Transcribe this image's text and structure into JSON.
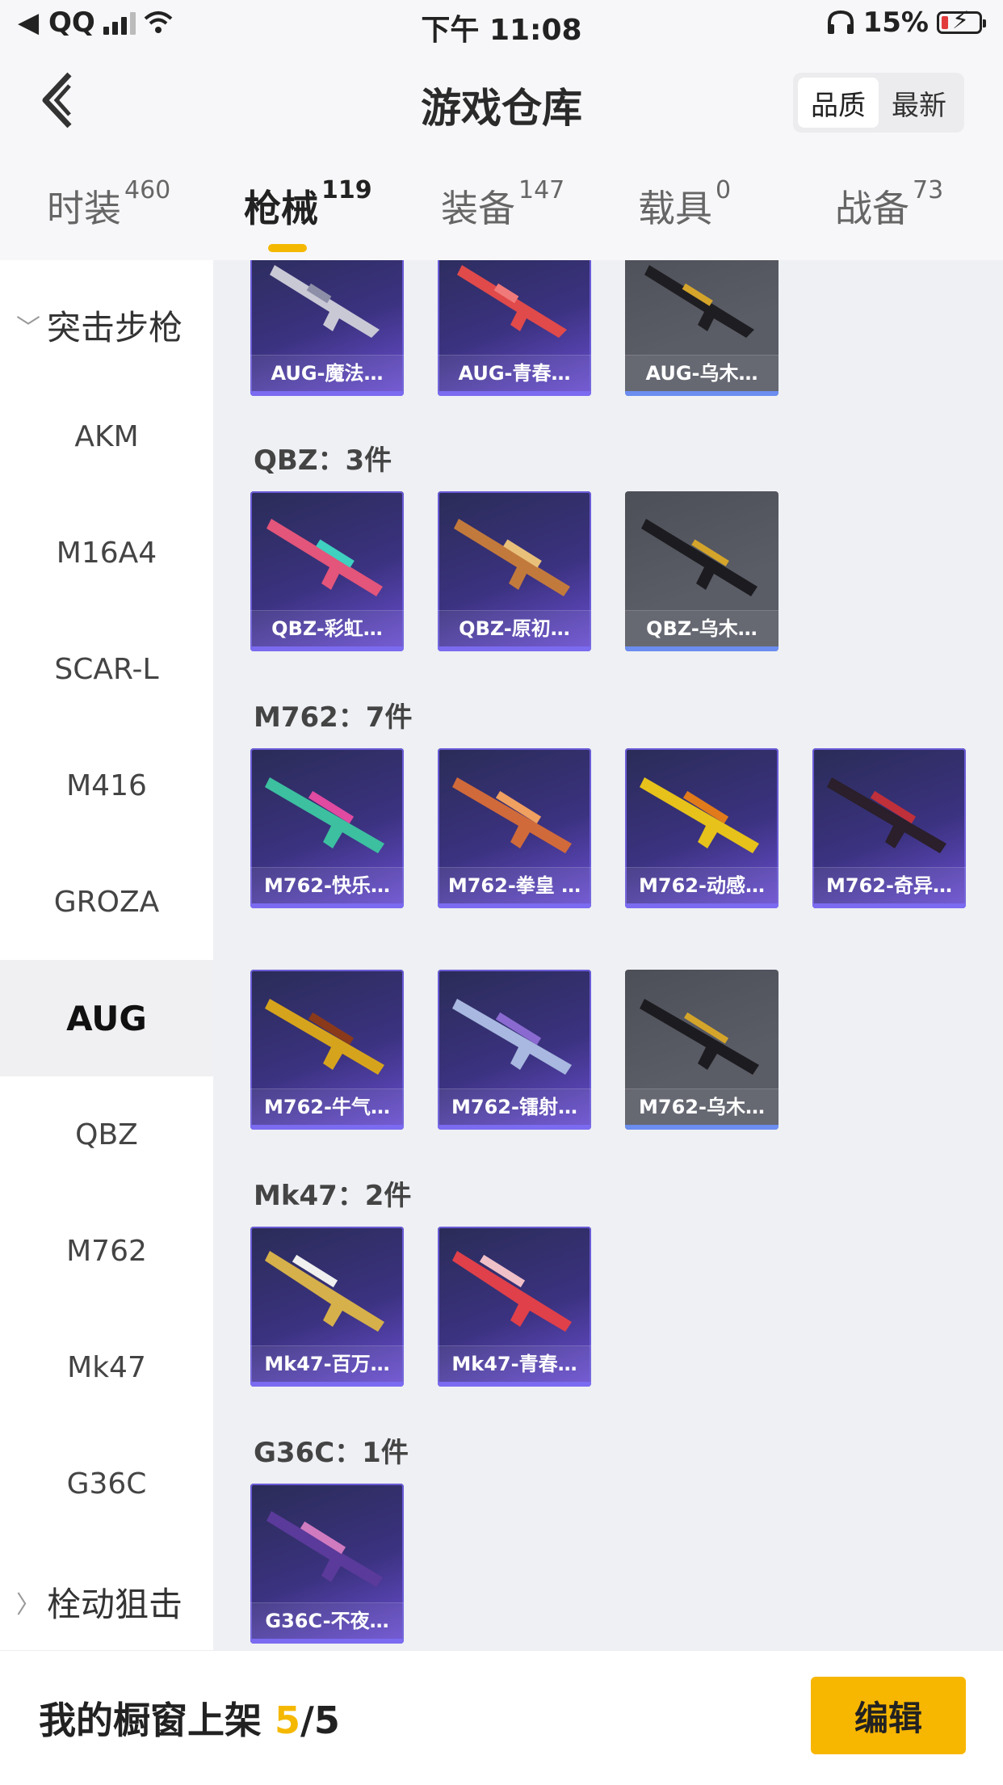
{
  "status_bar": {
    "carrier": "◀ QQ",
    "time": "下午 11:08",
    "battery_text": "15%"
  },
  "header": {
    "title": "游戏仓库",
    "sort_options": [
      "品质",
      "最新"
    ]
  },
  "tabs": [
    {
      "label": "时装",
      "count": "460"
    },
    {
      "label": "枪械",
      "count": "119"
    },
    {
      "label": "装备",
      "count": "147"
    },
    {
      "label": "载具",
      "count": "0"
    },
    {
      "label": "战备",
      "count": "73"
    }
  ],
  "sidebar": {
    "category_open": "突击步枪",
    "items": [
      "AKM",
      "M16A4",
      "SCAR-L",
      "M416",
      "GROZA",
      "AUG",
      "QBZ",
      "M762",
      "Mk47",
      "G36C"
    ],
    "category_closed": "栓动狙击"
  },
  "sections": [
    {
      "label": "",
      "cards": [
        {
          "name": "AUG-魔法…",
          "style": "purple"
        },
        {
          "name": "AUG-青春…",
          "style": "purple"
        },
        {
          "name": "AUG-乌木…",
          "style": "grey"
        }
      ]
    },
    {
      "label": "QBZ：3件",
      "cards": [
        {
          "name": "QBZ-彩虹…",
          "style": "purple"
        },
        {
          "name": "QBZ-原初…",
          "style": "purple"
        },
        {
          "name": "QBZ-乌木…",
          "style": "grey"
        }
      ]
    },
    {
      "label": "M762：7件",
      "cards": [
        {
          "name": "M762-快乐…",
          "style": "purple"
        },
        {
          "name": "M762-拳皇 …",
          "style": "purple"
        },
        {
          "name": "M762-动感…",
          "style": "purple"
        },
        {
          "name": "M762-奇异…",
          "style": "purple"
        },
        {
          "name": "M762-牛气…",
          "style": "purple"
        },
        {
          "name": "M762-镭射…",
          "style": "purple"
        },
        {
          "name": "M762-乌木…",
          "style": "grey"
        }
      ]
    },
    {
      "label": "Mk47：2件",
      "cards": [
        {
          "name": "Mk47-百万…",
          "style": "purple"
        },
        {
          "name": "Mk47-青春…",
          "style": "purple"
        }
      ]
    },
    {
      "label": "G36C：1件",
      "cards": [
        {
          "name": "G36C-不夜…",
          "style": "purple"
        }
      ]
    }
  ],
  "footer": {
    "shelf_label": "我的橱窗上架",
    "shelf_used": "5",
    "shelf_total": "/5",
    "edit_label": "编辑"
  },
  "colors": {
    "accent": "#f5b800",
    "card_purple": "#3b3280",
    "card_grey": "#55575f"
  }
}
